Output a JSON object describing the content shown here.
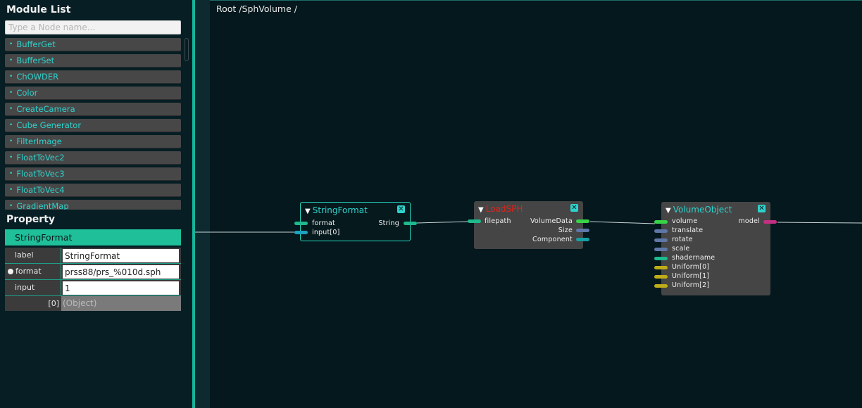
{
  "module_list": {
    "title": "Module List",
    "search_placeholder": "Type a Node name...",
    "items": [
      "BufferGet",
      "BufferSet",
      "ChOWDER",
      "Color",
      "CreateCamera",
      "Cube Generator",
      "FilterImage",
      "FloatToVec2",
      "FloatToVec3",
      "FloatToVec4",
      "GradientMap"
    ]
  },
  "property": {
    "title": "Property",
    "node_name": "StringFormat",
    "rows": [
      {
        "key": "label",
        "value": "StringFormat"
      },
      {
        "key": "format",
        "value": "prss88/prs_%010d.sph"
      },
      {
        "key": "input",
        "value": "1"
      }
    ],
    "sub_row": {
      "key": "[0]",
      "value": "(Object)"
    }
  },
  "canvas": {
    "breadcrumb": "Root /SphVolume /"
  },
  "nodes": {
    "string_format": {
      "title": "StringFormat",
      "inputs": [
        "format",
        "input[0]"
      ],
      "outputs": [
        "String"
      ]
    },
    "load_sph": {
      "title": "LoadSPH",
      "inputs": [
        "filepath"
      ],
      "outputs": [
        "VolumeData",
        "Size",
        "Component"
      ]
    },
    "volume_object": {
      "title": "VolumeObject",
      "inputs": [
        "volume",
        "translate",
        "rotate",
        "scale",
        "shadername",
        "Uniform[0]",
        "Uniform[1]",
        "Uniform[2]"
      ],
      "outputs": [
        "model"
      ]
    }
  },
  "icons": {
    "collapse": "triangle-down-icon",
    "close": "close-icon"
  },
  "colors": {
    "accent": "#1fbf9a",
    "error_title": "#e4211c"
  }
}
